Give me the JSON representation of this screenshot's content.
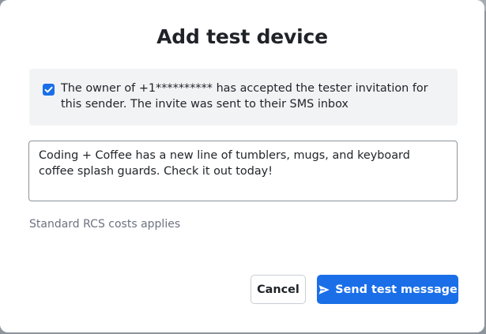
{
  "modal": {
    "title": "Add test device",
    "notice": {
      "checked": true,
      "text": "The owner of +1********** has accepted the tester invitation for this sender. The invite was sent to their SMS inbox"
    },
    "message": {
      "value": "Coding + Coffee has a new line of tumblers, mugs, and keyboard coffee splash guards. Check it out today!"
    },
    "cost_note": "Standard RCS costs applies",
    "buttons": {
      "cancel_label": "Cancel",
      "send_label": "Send test message"
    }
  },
  "icons": {
    "checkbox": "check-icon",
    "send": "paper-plane-icon"
  },
  "colors": {
    "primary": "#1a6fe8",
    "text": "#1f2328",
    "muted": "#6b7280",
    "notice_bg": "#f2f3f5"
  }
}
